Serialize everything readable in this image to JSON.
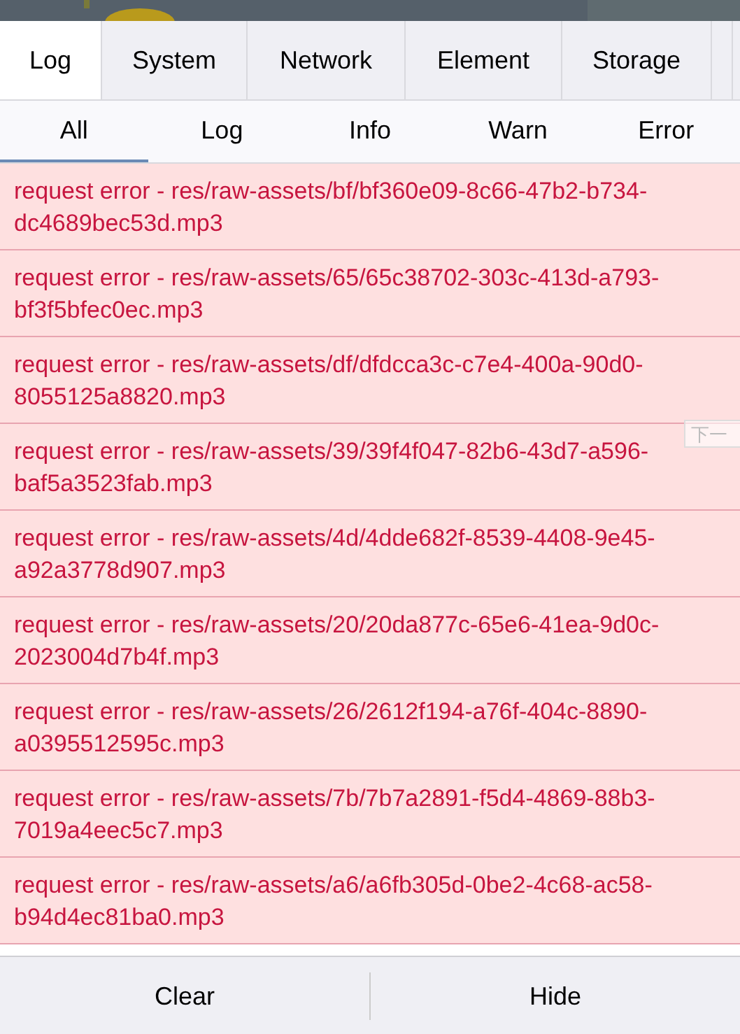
{
  "tabs": [
    {
      "label": "Log",
      "selected": true
    },
    {
      "label": "System",
      "selected": false
    },
    {
      "label": "Network",
      "selected": false
    },
    {
      "label": "Element",
      "selected": false
    },
    {
      "label": "Storage",
      "selected": false
    }
  ],
  "filters": [
    {
      "label": "All",
      "selected": true
    },
    {
      "label": "Log",
      "selected": false
    },
    {
      "label": "Info",
      "selected": false
    },
    {
      "label": "Warn",
      "selected": false
    },
    {
      "label": "Error",
      "selected": false
    }
  ],
  "entries": [
    {
      "kind": "error",
      "text": "request error - res/raw-assets/bf/bf360e09-8c66-47b2-b734-dc4689bec53d.mp3"
    },
    {
      "kind": "error",
      "text": "request error - res/raw-assets/65/65c38702-303c-413d-a793-bf3f5bfec0ec.mp3"
    },
    {
      "kind": "error",
      "text": "request error - res/raw-assets/df/dfdcca3c-c7e4-400a-90d0-8055125a8820.mp3"
    },
    {
      "kind": "error",
      "text": "request error - res/raw-assets/39/39f4f047-82b6-43d7-a596-baf5a3523fab.mp3"
    },
    {
      "kind": "error",
      "text": "request error - res/raw-assets/4d/4dde682f-8539-4408-9e45-a92a3778d907.mp3"
    },
    {
      "kind": "error",
      "text": "request error - res/raw-assets/20/20da877c-65e6-41ea-9d0c-2023004d7b4f.mp3"
    },
    {
      "kind": "error",
      "text": "request error - res/raw-assets/26/2612f194-a76f-404c-8890-a0395512595c.mp3"
    },
    {
      "kind": "error",
      "text": "request error - res/raw-assets/7b/7b7a2891-f5d4-4869-88b3-7019a4eec5c7.mp3"
    },
    {
      "kind": "error",
      "text": "request error - res/raw-assets/a6/a6fb305d-0be2-4c68-ac58-b94d4ec81ba0.mp3"
    }
  ],
  "overlay_button": {
    "label": "下一"
  },
  "footer": {
    "buttons": [
      "Clear",
      "Hide"
    ]
  }
}
